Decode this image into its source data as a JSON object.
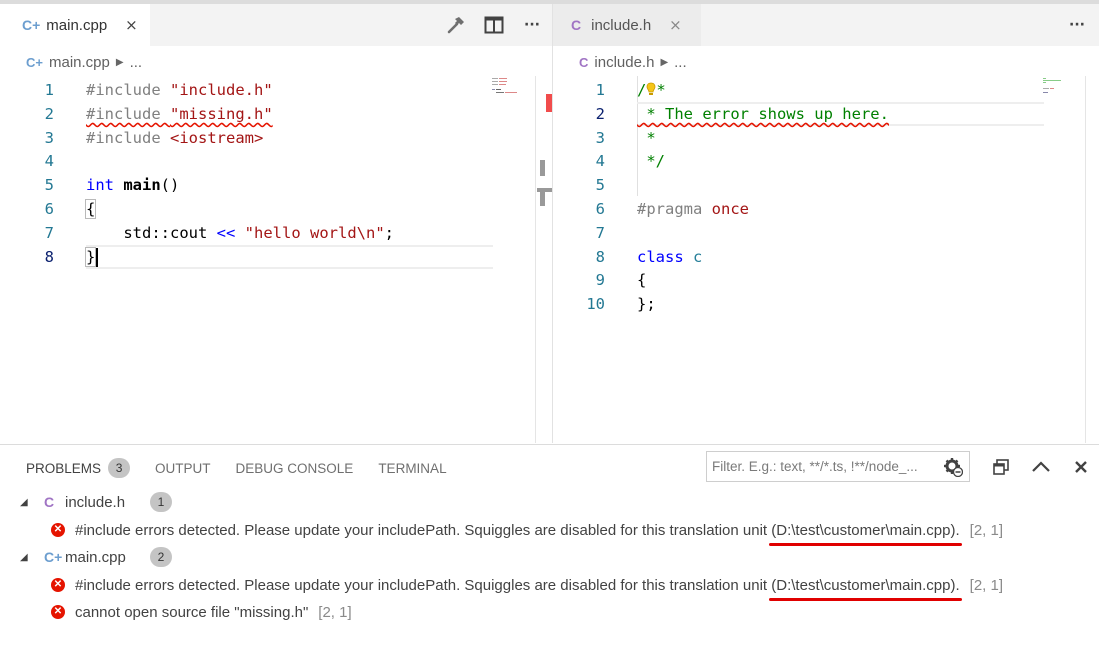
{
  "colors": {
    "cpp_icon": "#6c9ecf",
    "c_icon": "#a074c4",
    "error": "#e51400",
    "annotation": "#e00000"
  },
  "left_group": {
    "tab": {
      "icon": "C+",
      "label": "main.cpp",
      "close": "×"
    },
    "actions": [
      "hammer-icon",
      "split-editor-icon",
      "more-icon"
    ],
    "more_label": "···",
    "breadcrumb": {
      "icon": "C+",
      "file": "main.cpp",
      "sep": "▶",
      "rest": "..."
    },
    "lines": [
      {
        "n": "1",
        "parts": [
          {
            "t": "#include ",
            "c": "c-pp"
          },
          {
            "t": "\"include.h\"",
            "c": "c-str"
          }
        ]
      },
      {
        "n": "2",
        "parts": [
          {
            "t": "#include ",
            "c": "c-pp squiggle"
          },
          {
            "t": "\"missing.h\"",
            "c": "c-str squiggle"
          }
        ]
      },
      {
        "n": "3",
        "parts": [
          {
            "t": "#include ",
            "c": "c-pp"
          },
          {
            "t": "<iostream>",
            "c": "c-str"
          }
        ]
      },
      {
        "n": "4",
        "parts": []
      },
      {
        "n": "5",
        "parts": [
          {
            "t": "int ",
            "c": "c-kw"
          },
          {
            "t": "main",
            "c": "c-fn"
          },
          {
            "t": "()",
            "c": "c-op"
          }
        ]
      },
      {
        "n": "6",
        "parts": [
          {
            "t": "{",
            "c": "c-op bracket"
          }
        ]
      },
      {
        "n": "7",
        "parts": [
          {
            "t": "    std::cout ",
            "c": "c-op"
          },
          {
            "t": "<<",
            "c": "c-kw"
          },
          {
            "t": " ",
            "c": "c-op"
          },
          {
            "t": "\"hello world\\n\"",
            "c": "c-str"
          },
          {
            "t": ";",
            "c": "c-op"
          }
        ]
      },
      {
        "n": "8",
        "parts": [
          {
            "t": "}",
            "c": "c-op bracket"
          }
        ],
        "current": true
      }
    ]
  },
  "right_group": {
    "tab": {
      "icon": "C",
      "label": "include.h",
      "close": "×"
    },
    "actions": [
      "more-icon"
    ],
    "more_label": "···",
    "breadcrumb": {
      "icon": "C",
      "file": "include.h",
      "sep": "▶",
      "rest": "..."
    },
    "lines": [
      {
        "n": "1",
        "parts": [
          {
            "t": "/",
            "c": "c-cm"
          },
          {
            "t": "💡",
            "c": "c-cm bulb"
          },
          {
            "t": "*",
            "c": "c-cm"
          }
        ]
      },
      {
        "n": "2",
        "parts": [
          {
            "t": " * The error shows up here.",
            "c": "c-cm squiggle"
          }
        ],
        "current": true
      },
      {
        "n": "3",
        "parts": [
          {
            "t": " *",
            "c": "c-cm"
          }
        ]
      },
      {
        "n": "4",
        "parts": [
          {
            "t": " */",
            "c": "c-cm"
          }
        ]
      },
      {
        "n": "5",
        "parts": []
      },
      {
        "n": "6",
        "parts": [
          {
            "t": "#pragma ",
            "c": "c-pp"
          },
          {
            "t": "once",
            "c": "c-str"
          }
        ]
      },
      {
        "n": "7",
        "parts": []
      },
      {
        "n": "8",
        "parts": [
          {
            "t": "class ",
            "c": "c-kw"
          },
          {
            "t": "c",
            "c": "c-cls"
          }
        ]
      },
      {
        "n": "9",
        "parts": [
          {
            "t": "{",
            "c": "c-op"
          }
        ]
      },
      {
        "n": "10",
        "parts": [
          {
            "t": "};",
            "c": "c-op"
          }
        ]
      }
    ]
  },
  "panel": {
    "tabs": [
      {
        "label": "PROBLEMS",
        "badge": "3",
        "active": true
      },
      {
        "label": "OUTPUT"
      },
      {
        "label": "DEBUG CONSOLE"
      },
      {
        "label": "TERMINAL"
      }
    ],
    "filter_placeholder": "Filter. E.g.: text, **/*.ts, !**/node_...",
    "actions": [
      "filter-settings-icon",
      "maximize-panel-icon",
      "collapse-panel-icon",
      "close-panel-icon"
    ],
    "groups": [
      {
        "icon": "C",
        "file": "include.h",
        "count": "1",
        "problems": [
          {
            "text": "#include errors detected. Please update your includePath. Squiggles are disabled for this translation unit ",
            "path": "(D:\\test\\customer\\main.cpp).",
            "loc": "[2, 1]"
          }
        ]
      },
      {
        "icon": "C+",
        "file": "main.cpp",
        "count": "2",
        "problems": [
          {
            "text": "#include errors detected. Please update your includePath. Squiggles are disabled for this translation unit ",
            "path": "(D:\\test\\customer\\main.cpp).",
            "loc": "[2, 1]"
          },
          {
            "text": "cannot open source file \"missing.h\"",
            "path": "",
            "loc": "[2, 1]"
          }
        ]
      }
    ]
  }
}
